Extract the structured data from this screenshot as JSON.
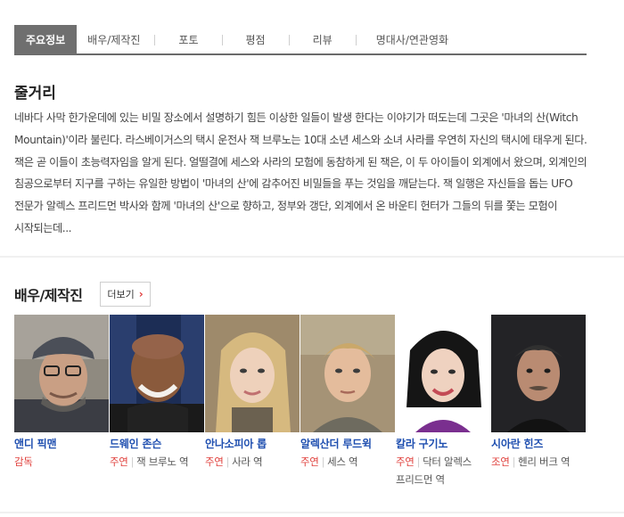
{
  "tabs": [
    {
      "label": "주요정보"
    },
    {
      "label": "배우/제작진"
    },
    {
      "label": "포토"
    },
    {
      "label": "평점"
    },
    {
      "label": "리뷰"
    },
    {
      "label": "명대사/연관영화"
    }
  ],
  "synopsis": {
    "title": "줄거리",
    "text": "네바다 사막 한가운데에 있는 비밀 장소에서 설명하기 힘든 이상한 일들이 발생 한다는 이야기가 떠도는데 그곳은 '마녀의 산(Witch Mountain)'이라 불린다. 라스베이거스의 택시 운전사 잭 브루노는 10대 소년 세스와 소녀 사라를 우연히 자신의 택시에 태우게 된다. 잭은 곧 이들이 초능력자임을 알게 된다. 얼떨결에 세스와 사라의 모험에 동참하게 된 잭은, 이 두 아이들이 외계에서 왔으며, 외계인의 침공으로부터 지구를 구하는 유일한 방법이 '마녀의 산'에 감추어진 비밀들을 푸는 것임을 깨닫는다. 잭 일행은 자신들을 돕는 UFO 전문가 알렉스 프리드먼 박사와 함께 '마녀의 산'으로 향하고, 정부와 갱단, 외계에서 온 바운티 헌터가 그들의 뒤를 쫓는 모험이 시작되는데..."
  },
  "cast": {
    "title": "배우/제작진",
    "more_label": "더보기",
    "more_arrow": "›",
    "members": [
      {
        "name": "앤디 픽맨",
        "role_type": "감독",
        "role": ""
      },
      {
        "name": "드웨인 존슨",
        "role_type": "주연",
        "role": "잭 브루노 역"
      },
      {
        "name": "안나소피아 롭",
        "role_type": "주연",
        "role": "사라 역"
      },
      {
        "name": "알렉산더 루드윅",
        "role_type": "주연",
        "role": "세스 역"
      },
      {
        "name": "칼라 구기노",
        "role_type": "주연",
        "role": "닥터 알렉스 프리드먼 역"
      },
      {
        "name": "시아란 힌즈",
        "role_type": "조연",
        "role": "헨리 버크 역"
      }
    ]
  },
  "colors": {
    "active_tab": "#6f6f6f",
    "cast_name": "#1f4fb0",
    "role_type": "#e0413d"
  }
}
